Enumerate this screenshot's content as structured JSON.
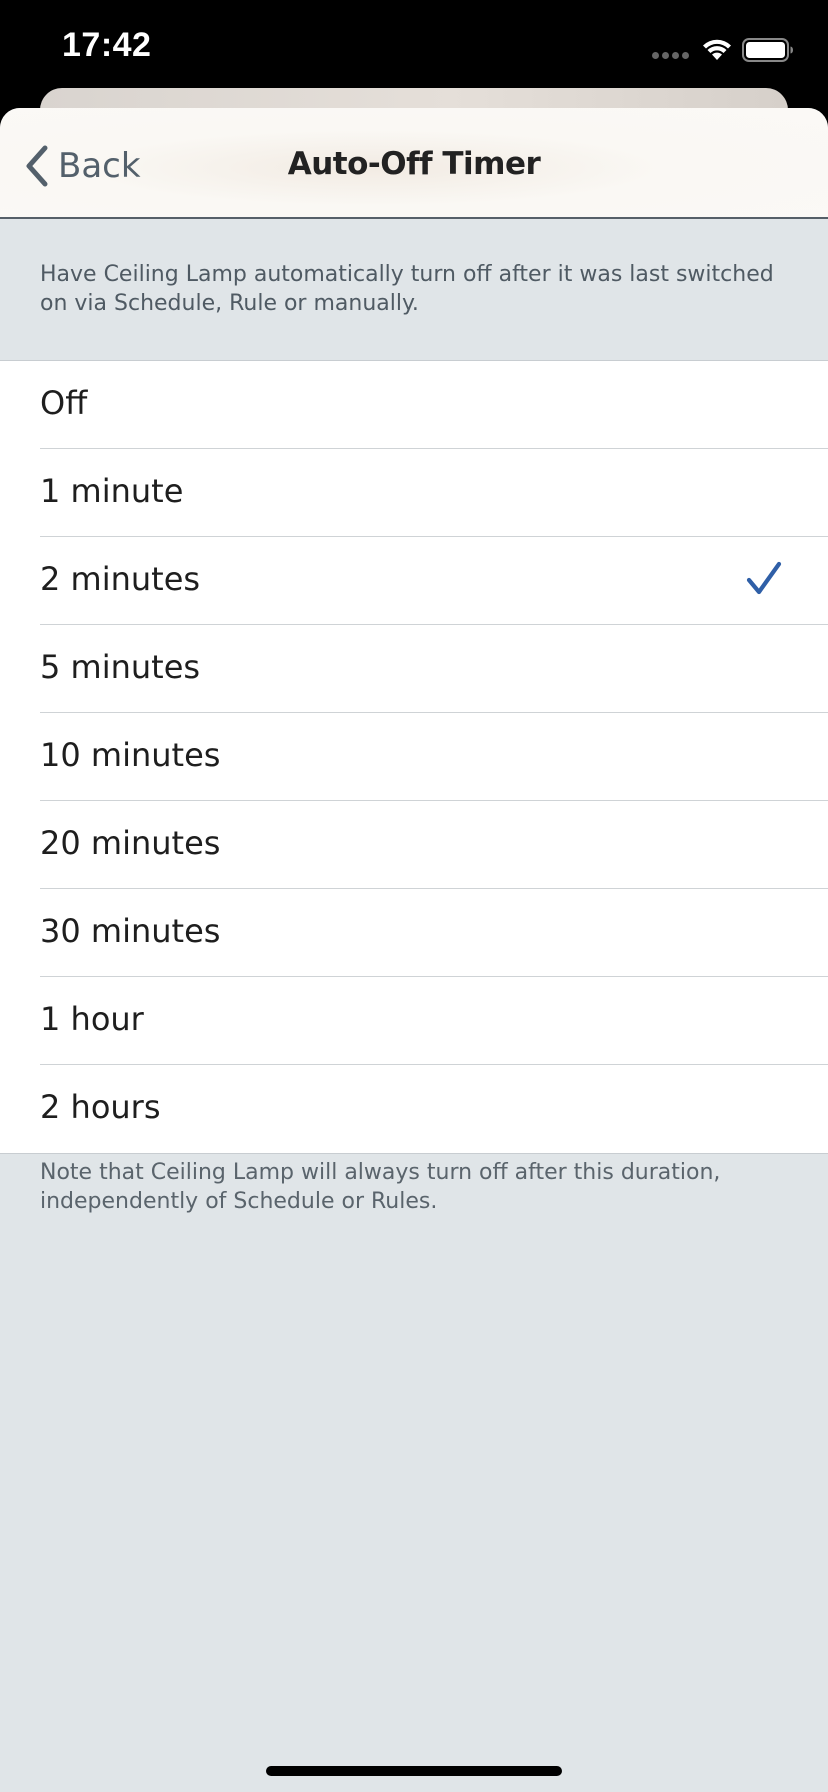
{
  "status_bar": {
    "time": "17:42"
  },
  "nav": {
    "back_label": "Back",
    "title": "Auto-Off Timer"
  },
  "header_note": "Have Ceiling Lamp automatically turn off after it was last switched on via Schedule, Rule or manually.",
  "options": [
    {
      "label": "Off",
      "selected": false
    },
    {
      "label": "1 minute",
      "selected": false
    },
    {
      "label": "2 minutes",
      "selected": true
    },
    {
      "label": "5 minutes",
      "selected": false
    },
    {
      "label": "10 minutes",
      "selected": false
    },
    {
      "label": "20 minutes",
      "selected": false
    },
    {
      "label": "30 minutes",
      "selected": false
    },
    {
      "label": "1 hour",
      "selected": false
    },
    {
      "label": "2 hours",
      "selected": false
    }
  ],
  "footer_note": "Note that Ceiling Lamp will always turn off after this duration, independently of Schedule or Rules.",
  "colors": {
    "accent_check": "#2f5fa7",
    "background": "#e0e5e8",
    "nav_text": "#53606b"
  },
  "icons": {
    "back": "chevron-left-icon",
    "selected": "checkmark-icon",
    "wifi": "wifi-icon",
    "battery": "battery-icon"
  }
}
